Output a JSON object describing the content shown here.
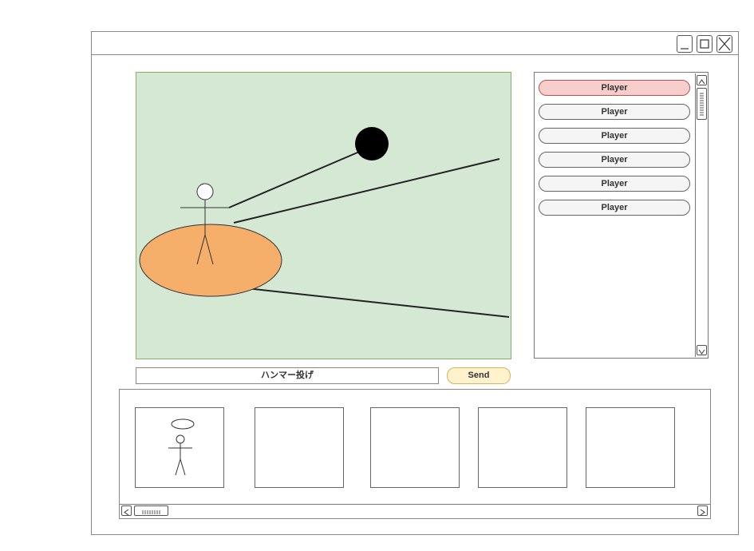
{
  "window": {
    "controls": [
      "minimize-icon",
      "maximize-icon",
      "close-icon"
    ]
  },
  "game": {
    "colors": {
      "field": "#d5e8d4",
      "circle": "#f5af6a",
      "hammer": "#000000"
    }
  },
  "players": {
    "items": [
      {
        "label": "Player",
        "selected": true
      },
      {
        "label": "Player",
        "selected": false
      },
      {
        "label": "Player",
        "selected": false
      },
      {
        "label": "Player",
        "selected": false
      },
      {
        "label": "Player",
        "selected": false
      },
      {
        "label": "Player",
        "selected": false
      }
    ]
  },
  "chat": {
    "input_value": "ハンマー投げ",
    "send_label": "Send"
  },
  "thumbnails": {
    "count": 5
  }
}
